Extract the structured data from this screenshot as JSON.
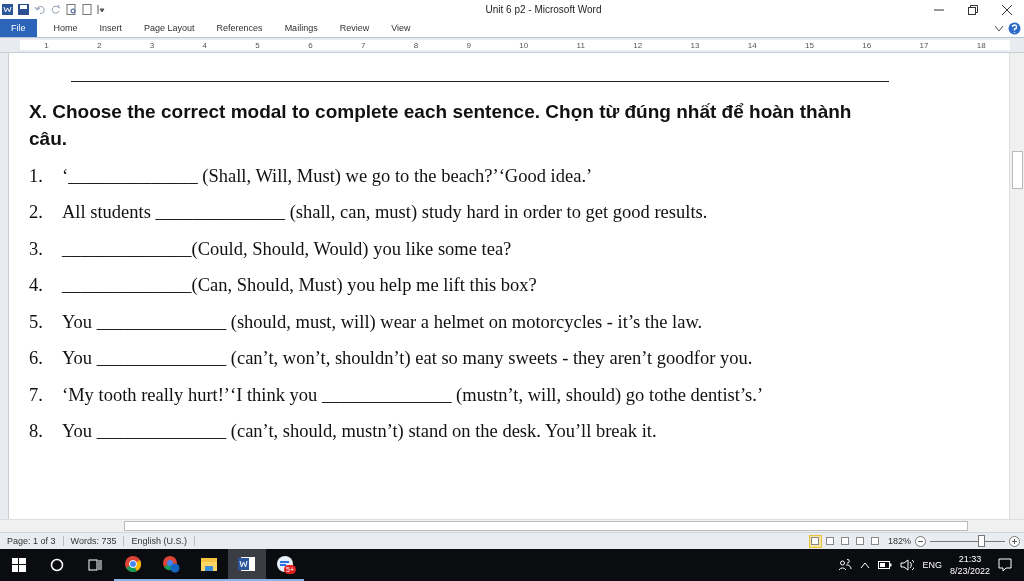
{
  "window": {
    "title": "Unit 6 p2  -  Microsoft Word"
  },
  "ribbon_tabs": [
    {
      "label": "File",
      "selected": false,
      "kind": "file"
    },
    {
      "label": "Home",
      "selected": false,
      "kind": "tab"
    },
    {
      "label": "Insert",
      "selected": false,
      "kind": "tab"
    },
    {
      "label": "Page Layout",
      "selected": false,
      "kind": "tab"
    },
    {
      "label": "References",
      "selected": false,
      "kind": "tab"
    },
    {
      "label": "Mailings",
      "selected": false,
      "kind": "tab"
    },
    {
      "label": "Review",
      "selected": false,
      "kind": "tab"
    },
    {
      "label": "View",
      "selected": false,
      "kind": "tab"
    }
  ],
  "ruler_numbers": [
    "1",
    "2",
    "3",
    "4",
    "5",
    "6",
    "7",
    "8",
    "9",
    "10",
    "11",
    "12",
    "13",
    "14",
    "15",
    "16",
    "17",
    "18"
  ],
  "document": {
    "heading": "X.  Choose the correct modal to complete each sentence. Chọn từ đúng nhất để hoàn thành câu.",
    "items": [
      {
        "number": "1.",
        "text": "‘______________ (Shall, Will, Must) we go to the beach?’‘Good idea.’"
      },
      {
        "number": "2.",
        "text": "All students ______________ (shall, can, must) study hard in order to get good results."
      },
      {
        "number": "3.",
        "text": "______________(Could, Should, Would) you like some tea?"
      },
      {
        "number": "4.",
        "text": "______________(Can, Should, Must) you help me lift this box?"
      },
      {
        "number": "5.",
        "text": "You ______________ (should, must, will) wear a helmet on motorcycles - it’s the law."
      },
      {
        "number": "6.",
        "text": "You ______________ (can’t, won’t, shouldn’t) eat so many sweets - they aren’t goodfor you."
      },
      {
        "number": "7.",
        "text": "‘My tooth really hurt!’‘I think you ______________ (mustn’t, will, should) go tothe dentist’s.’"
      },
      {
        "number": "8.",
        "text": "You ______________ (can’t, should, mustn’t) stand on the desk. You’ll break it."
      }
    ]
  },
  "status_bar": {
    "page": "Page: 1 of 3",
    "words": "Words: 735",
    "language": "English (U.S.)",
    "view_buttons": [
      {
        "selected": true
      },
      {
        "selected": false
      },
      {
        "selected": false
      },
      {
        "selected": false
      },
      {
        "selected": false
      }
    ],
    "zoom": "182%",
    "zoom_slider": {
      "level": 0.7
    }
  },
  "taskbar": {
    "apps": [
      {
        "kind": "chrome",
        "active": false
      },
      {
        "kind": "chrome-profile",
        "active": false
      },
      {
        "kind": "folder",
        "active": false
      },
      {
        "kind": "word",
        "active": true
      },
      {
        "kind": "chat",
        "active": false,
        "badge": "5+"
      }
    ],
    "language": "ENG",
    "time": "21:33",
    "date": "8/23/2022"
  }
}
